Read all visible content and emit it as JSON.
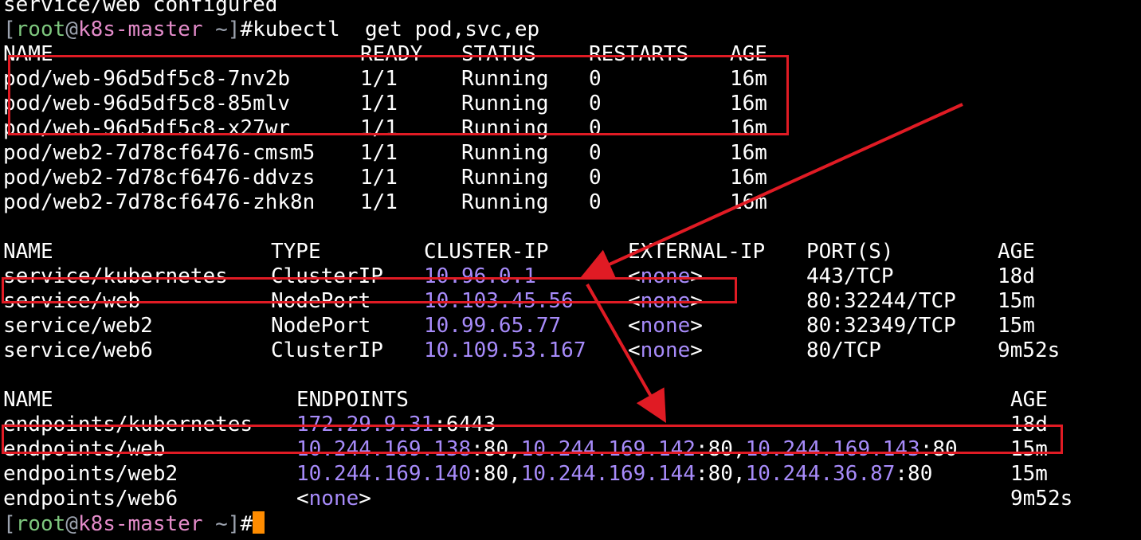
{
  "terminal": {
    "prev_line": "service/web configured",
    "prompt": {
      "open": "[",
      "user": "root",
      "at": "@",
      "host": "k8s-master",
      "path": " ~",
      "close": "]",
      "sign": "#"
    },
    "command": "kubectl  get pod,svc,ep",
    "pods": {
      "headers": [
        "NAME",
        "READY",
        "STATUS",
        "RESTARTS",
        "AGE"
      ],
      "rows": [
        [
          "pod/web-96d5df5c8-7nv2b",
          "1/1",
          "Running",
          "0",
          "16m"
        ],
        [
          "pod/web-96d5df5c8-85mlv",
          "1/1",
          "Running",
          "0",
          "16m"
        ],
        [
          "pod/web-96d5df5c8-x27wr",
          "1/1",
          "Running",
          "0",
          "16m"
        ],
        [
          "pod/web2-7d78cf6476-cmsm5",
          "1/1",
          "Running",
          "0",
          "16m"
        ],
        [
          "pod/web2-7d78cf6476-ddvzs",
          "1/1",
          "Running",
          "0",
          "16m"
        ],
        [
          "pod/web2-7d78cf6476-zhk8n",
          "1/1",
          "Running",
          "0",
          "16m"
        ]
      ]
    },
    "services": {
      "headers": [
        "NAME",
        "TYPE",
        "CLUSTER-IP",
        "EXTERNAL-IP",
        "PORT(S)",
        "AGE"
      ],
      "rows": [
        [
          "service/kubernetes",
          "ClusterIP",
          "10.96.0.1",
          "<",
          "none",
          ">",
          "443/TCP",
          "18d"
        ],
        [
          "service/web",
          "NodePort",
          "10.103.45.56",
          "<",
          "none",
          ">",
          "80:32244/TCP",
          "15m"
        ],
        [
          "service/web2",
          "NodePort",
          "10.99.65.77",
          "<",
          "none",
          ">",
          "80:32349/TCP",
          "15m"
        ],
        [
          "service/web6",
          "ClusterIP",
          "10.109.53.167",
          "<",
          "none",
          ">",
          "80/TCP",
          "9m52s"
        ]
      ]
    },
    "endpoints": {
      "headers": [
        "NAME",
        "ENDPOINTS",
        "AGE"
      ],
      "rows": [
        {
          "name": "endpoints/kubernetes",
          "eps": [
            [
              "172.29.9.31",
              ":6443"
            ]
          ],
          "age": "18d"
        },
        {
          "name": "endpoints/web",
          "eps": [
            [
              "10.244.169.138",
              ":80,"
            ],
            [
              "10.244.169.142",
              ":80,"
            ],
            [
              "10.244.169.143",
              ":80"
            ]
          ],
          "age": "15m"
        },
        {
          "name": "endpoints/web2",
          "eps": [
            [
              "10.244.169.140",
              ":80,"
            ],
            [
              "10.244.169.144",
              ":80,"
            ],
            [
              "10.244.36.87",
              ":80"
            ]
          ],
          "age": "15m"
        },
        {
          "name": "endpoints/web6",
          "eps": [
            [
              "<",
              ""
            ],
            [
              "none",
              ""
            ],
            [
              ">",
              ""
            ]
          ],
          "age": "9m52s"
        }
      ]
    }
  }
}
